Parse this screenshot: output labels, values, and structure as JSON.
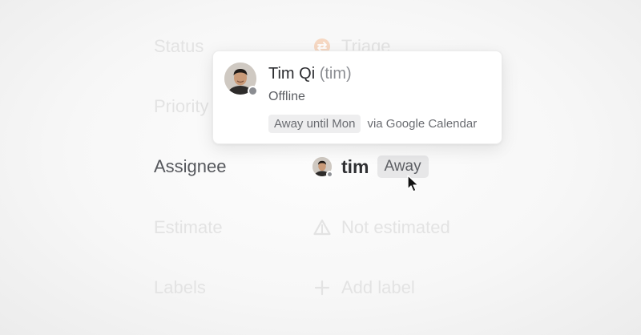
{
  "fields": {
    "status": {
      "label": "Status",
      "value": "Triage",
      "icon": "triage-icon"
    },
    "priority": {
      "label": "Priority"
    },
    "assignee": {
      "label": "Assignee",
      "username": "tim",
      "badge": "Away"
    },
    "estimate": {
      "label": "Estimate",
      "value": "Not estimated",
      "icon": "warning-triangle-icon"
    },
    "labels": {
      "label": "Labels",
      "value": "Add label",
      "icon": "plus-icon"
    }
  },
  "popover": {
    "full_name": "Tim Qi",
    "handle": "(tim)",
    "status": "Offline",
    "chip": "Away until Mon",
    "via": "via Google Calendar"
  },
  "colors": {
    "presence_offline": "#8f9196",
    "triage_orange": "#f4b183",
    "badge_bg": "#e7e7e8"
  }
}
